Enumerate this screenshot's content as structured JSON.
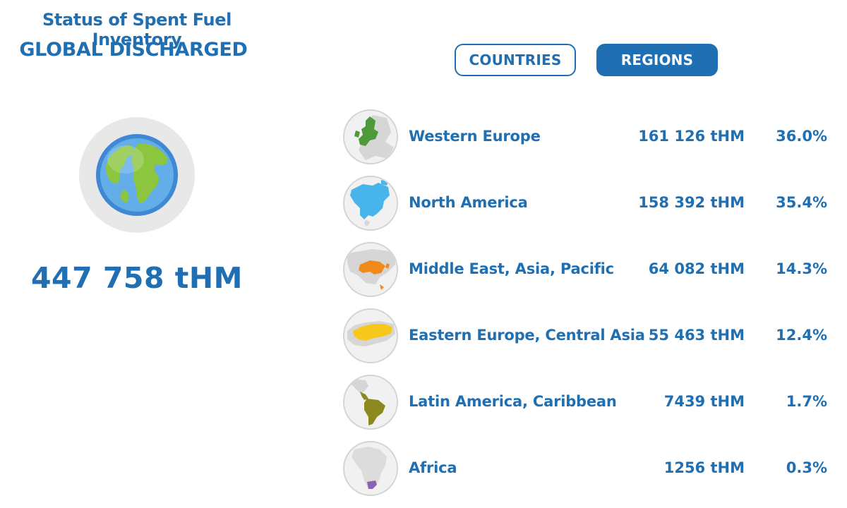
{
  "header": {
    "title": "Status of Spent Fuel Inventory",
    "subtitle": "GLOBAL DISCHARGED"
  },
  "tabs": {
    "countries_label": "COUNTRIES",
    "regions_label": "REGIONS",
    "active": "REGIONS"
  },
  "summary": {
    "icon": "globe-icon",
    "total": "447 758 tHM"
  },
  "regions": [
    {
      "name": "Western Europe",
      "amount": "161 126 tHM",
      "percent": "36.0%",
      "icon": "western-europe-map-icon",
      "color": "#4e9a3a"
    },
    {
      "name": "North America",
      "amount": "158 392 tHM",
      "percent": "35.4%",
      "icon": "north-america-map-icon",
      "color": "#47b4ea"
    },
    {
      "name": "Middle East, Asia, Pacific",
      "amount": "64 082 tHM",
      "percent": "14.3%",
      "icon": "asia-pacific-map-icon",
      "color": "#f08a1c"
    },
    {
      "name": "Eastern Europe, Central Asia",
      "amount": "55 463 tHM",
      "percent": "12.4%",
      "icon": "eastern-europe-map-icon",
      "color": "#f6c81e"
    },
    {
      "name": "Latin America, Caribbean",
      "amount": "7439 tHM",
      "percent": "1.7%",
      "icon": "latin-america-map-icon",
      "color": "#8c8a1e"
    },
    {
      "name": "Africa",
      "amount": "1256 tHM",
      "percent": "0.3%",
      "icon": "africa-map-icon",
      "color": "#8a62b4"
    }
  ],
  "colors": {
    "primary": "#1f6fb2",
    "background": "#ffffff",
    "globe_ring": "#e8e8e8",
    "map_base": "#d6d6d6"
  }
}
